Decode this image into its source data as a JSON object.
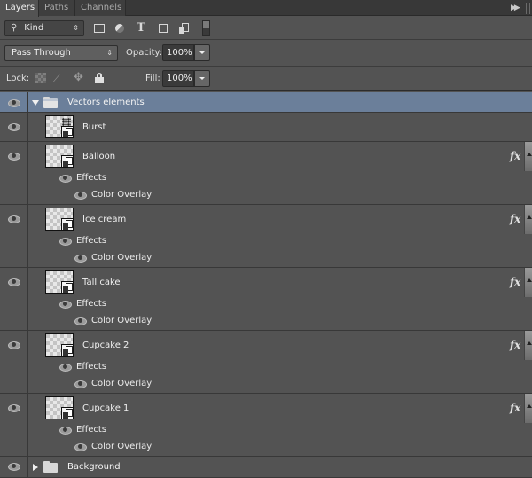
{
  "tabs": [
    {
      "label": "Layers",
      "active": true
    },
    {
      "label": "Paths",
      "active": false
    },
    {
      "label": "Channels",
      "active": false
    }
  ],
  "filter": {
    "kind_label": "Kind",
    "icons": [
      "image-filter-icon",
      "adjustment-filter-icon",
      "type-filter-icon",
      "shape-filter-icon",
      "smart-object-filter-icon"
    ],
    "type_glyph": "T"
  },
  "blend": {
    "mode": "Pass Through",
    "opacity_label": "Opacity:",
    "opacity_value": "100%"
  },
  "lock": {
    "label": "Lock:",
    "fill_label": "Fill:",
    "fill_value": "100%"
  },
  "icons": {
    "panel_menu": "▶▶",
    "updown": "⇕",
    "search": "⚲",
    "paint": "⟋",
    "move": "✥",
    "fx": "fx"
  },
  "layers": [
    {
      "type": "group",
      "name": "Vectors elements",
      "expanded": true,
      "selected": true,
      "visible": true
    },
    {
      "type": "smart",
      "name": "Burst",
      "visible": true,
      "fx": false
    },
    {
      "type": "smart",
      "name": "Balloon",
      "visible": true,
      "fx": true,
      "effects_label": "Effects",
      "effect": "Color Overlay"
    },
    {
      "type": "smart",
      "name": "Ice cream",
      "visible": true,
      "fx": true,
      "effects_label": "Effects",
      "effect": "Color Overlay"
    },
    {
      "type": "smart",
      "name": "Tall cake",
      "visible": true,
      "fx": true,
      "effects_label": "Effects",
      "effect": "Color Overlay"
    },
    {
      "type": "smart",
      "name": "Cupcake 2",
      "visible": true,
      "fx": true,
      "effects_label": "Effects",
      "effect": "Color Overlay"
    },
    {
      "type": "smart",
      "name": "Cupcake 1",
      "visible": true,
      "fx": true,
      "effects_label": "Effects",
      "effect": "Color Overlay"
    },
    {
      "type": "group",
      "name": "Background",
      "expanded": false,
      "selected": false,
      "visible": true
    }
  ],
  "colors": {
    "panel_bg": "#535353",
    "selected_row": "#6b7f9a",
    "tab_bar": "#383838"
  }
}
